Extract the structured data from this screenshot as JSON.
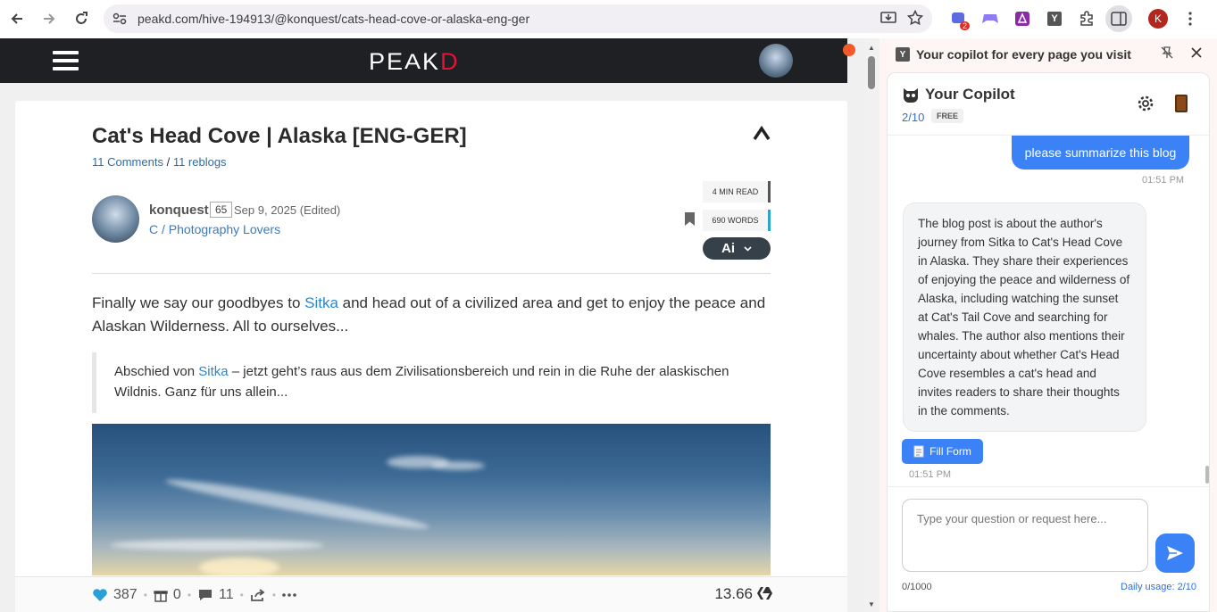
{
  "browser": {
    "url": "peakd.com/hive-194913/@konquest/cats-head-cove-or-alaska-eng-ger",
    "ext_badge": "2",
    "profile_initial": "K"
  },
  "peakd": {
    "logo_left": "PE",
    "logo_mid": "A",
    "logo_k": "K",
    "logo_right": "D"
  },
  "post": {
    "title": "Cat's Head Cove | Alaska [ENG-GER]",
    "comments": "11 Comments",
    "sep": " / ",
    "reblogs": "11 reblogs",
    "author": "konquest",
    "reputation": "65",
    "date": "Sep 9, 2025 (Edited)",
    "community": "C / Photography Lovers",
    "read_time": "4 MIN READ",
    "words": "690 WORDS",
    "ai_label": "Ai",
    "para_before": "Finally we say our goodbyes to ",
    "para_link": "Sitka",
    "para_after": " and head out of a civilized area and get to enjoy the peace and Alaskan Wilderness. All to ourselves...",
    "quote_before": "Abschied von ",
    "quote_link": "Sitka",
    "quote_after": " – jetzt geht’s raus aus dem Zivilisationsbereich und rein in die Ruhe der alaskischen Wildnis. Ganz für uns allein...",
    "votes": "387",
    "tips": "0",
    "comment_count": "11",
    "payout": "13.66"
  },
  "panel": {
    "top_title": "Your copilot for every page you visit",
    "name": "Your Copilot",
    "count": "2/10",
    "plan": "FREE",
    "user_message": "please summarize this blog",
    "user_time": "01:51 PM",
    "bot_message": "The blog post is about the author's journey from Sitka to Cat's Head Cove in Alaska. They share their experiences of enjoying the peace and wilderness of Alaska, including watching the sunset at Cat's Tail Cove and searching for whales. The author also mentions their uncertainty about whether Cat's Head Cove resembles a cat's head and invites readers to share their thoughts in the comments.",
    "fill_form": "Fill Form",
    "bot_time": "01:51 PM",
    "input_placeholder": "Type your question or request here...",
    "char_count": "0/1000",
    "daily_usage": "Daily usage: 2/10"
  }
}
